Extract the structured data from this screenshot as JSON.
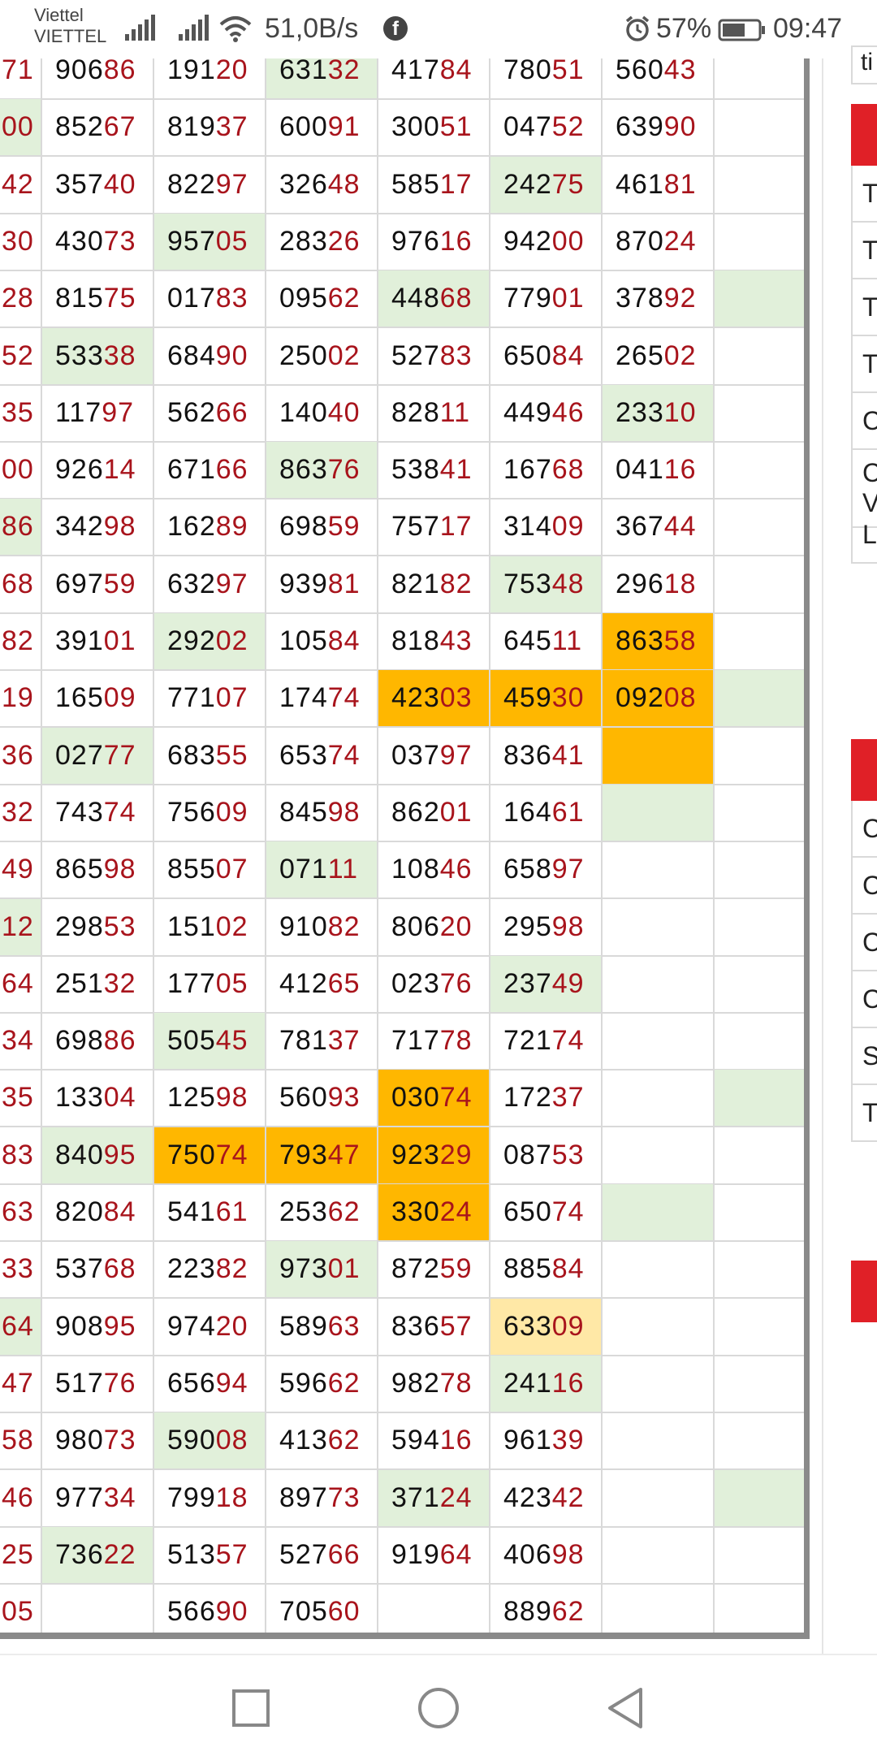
{
  "status_bar": {
    "carrier_line1": "Viettel",
    "carrier_line2": "VIETTEL",
    "net_speed": "51,0B/s",
    "battery": "57%",
    "time": "09:47",
    "icons": [
      "signal-icon",
      "signal-icon",
      "wifi-icon",
      "facebook-icon",
      "alarm-icon",
      "battery-icon"
    ]
  },
  "table": {
    "rows": [
      [
        {
          "a": "",
          "b": "71"
        },
        {
          "a": "906",
          "b": "86",
          "bg": ""
        },
        {
          "a": "191",
          "b": "20",
          "bg": ""
        },
        {
          "a": "631",
          "b": "32",
          "bg": "green"
        },
        {
          "a": "417",
          "b": "84",
          "bg": ""
        },
        {
          "a": "780",
          "b": "51",
          "bg": ""
        },
        {
          "a": "560",
          "b": "43",
          "bg": ""
        },
        {
          "a": "",
          "b": "",
          "bg": ""
        }
      ],
      [
        {
          "a": "",
          "b": "00",
          "bg": "green"
        },
        {
          "a": "852",
          "b": "67",
          "bg": ""
        },
        {
          "a": "819",
          "b": "37",
          "bg": ""
        },
        {
          "a": "600",
          "b": "91",
          "bg": ""
        },
        {
          "a": "300",
          "b": "51",
          "bg": ""
        },
        {
          "a": "047",
          "b": "52",
          "bg": ""
        },
        {
          "a": "639",
          "b": "90",
          "bg": ""
        },
        {
          "a": "",
          "b": "",
          "bg": ""
        }
      ],
      [
        {
          "a": "",
          "b": "42"
        },
        {
          "a": "357",
          "b": "40",
          "bg": ""
        },
        {
          "a": "822",
          "b": "97",
          "bg": ""
        },
        {
          "a": "326",
          "b": "48",
          "bg": ""
        },
        {
          "a": "585",
          "b": "17",
          "bg": ""
        },
        {
          "a": "242",
          "b": "75",
          "bg": "green"
        },
        {
          "a": "461",
          "b": "81",
          "bg": ""
        },
        {
          "a": "",
          "b": "",
          "bg": ""
        }
      ],
      [
        {
          "a": "",
          "b": "30"
        },
        {
          "a": "430",
          "b": "73",
          "bg": ""
        },
        {
          "a": "957",
          "b": "05",
          "bg": "green"
        },
        {
          "a": "283",
          "b": "26",
          "bg": ""
        },
        {
          "a": "976",
          "b": "16",
          "bg": ""
        },
        {
          "a": "942",
          "b": "00",
          "bg": ""
        },
        {
          "a": "870",
          "b": "24",
          "bg": ""
        },
        {
          "a": "",
          "b": "",
          "bg": ""
        }
      ],
      [
        {
          "a": "",
          "b": "28"
        },
        {
          "a": "815",
          "b": "75",
          "bg": ""
        },
        {
          "a": "017",
          "b": "83",
          "bg": ""
        },
        {
          "a": "095",
          "b": "62",
          "bg": ""
        },
        {
          "a": "448",
          "b": "68",
          "bg": "green"
        },
        {
          "a": "779",
          "b": "01",
          "bg": ""
        },
        {
          "a": "378",
          "b": "92",
          "bg": ""
        },
        {
          "a": "",
          "b": "",
          "bg": "green"
        }
      ],
      [
        {
          "a": "",
          "b": "52"
        },
        {
          "a": "533",
          "b": "38",
          "bg": "green"
        },
        {
          "a": "684",
          "b": "90",
          "bg": ""
        },
        {
          "a": "250",
          "b": "02",
          "bg": ""
        },
        {
          "a": "527",
          "b": "83",
          "bg": ""
        },
        {
          "a": "650",
          "b": "84",
          "bg": ""
        },
        {
          "a": "265",
          "b": "02",
          "bg": ""
        },
        {
          "a": "",
          "b": "",
          "bg": ""
        }
      ],
      [
        {
          "a": "",
          "b": "35"
        },
        {
          "a": "117",
          "b": "97",
          "bg": ""
        },
        {
          "a": "562",
          "b": "66",
          "bg": ""
        },
        {
          "a": "140",
          "b": "40",
          "bg": ""
        },
        {
          "a": "828",
          "b": "11",
          "bg": ""
        },
        {
          "a": "449",
          "b": "46",
          "bg": ""
        },
        {
          "a": "233",
          "b": "10",
          "bg": "green"
        },
        {
          "a": "",
          "b": "",
          "bg": ""
        }
      ],
      [
        {
          "a": "",
          "b": "00"
        },
        {
          "a": "926",
          "b": "14",
          "bg": ""
        },
        {
          "a": "671",
          "b": "66",
          "bg": ""
        },
        {
          "a": "863",
          "b": "76",
          "bg": "green"
        },
        {
          "a": "538",
          "b": "41",
          "bg": ""
        },
        {
          "a": "167",
          "b": "68",
          "bg": ""
        },
        {
          "a": "041",
          "b": "16",
          "bg": ""
        },
        {
          "a": "",
          "b": "",
          "bg": ""
        }
      ],
      [
        {
          "a": "",
          "b": "86",
          "bg": "green"
        },
        {
          "a": "342",
          "b": "98",
          "bg": ""
        },
        {
          "a": "162",
          "b": "89",
          "bg": ""
        },
        {
          "a": "698",
          "b": "59",
          "bg": ""
        },
        {
          "a": "757",
          "b": "17",
          "bg": ""
        },
        {
          "a": "314",
          "b": "09",
          "bg": ""
        },
        {
          "a": "367",
          "b": "44",
          "bg": ""
        },
        {
          "a": "",
          "b": "",
          "bg": ""
        }
      ],
      [
        {
          "a": "",
          "b": "68"
        },
        {
          "a": "697",
          "b": "59",
          "bg": ""
        },
        {
          "a": "632",
          "b": "97",
          "bg": ""
        },
        {
          "a": "939",
          "b": "81",
          "bg": ""
        },
        {
          "a": "821",
          "b": "82",
          "bg": ""
        },
        {
          "a": "753",
          "b": "48",
          "bg": "green"
        },
        {
          "a": "296",
          "b": "18",
          "bg": ""
        },
        {
          "a": "",
          "b": "",
          "bg": ""
        }
      ],
      [
        {
          "a": "",
          "b": "82"
        },
        {
          "a": "391",
          "b": "01",
          "bg": ""
        },
        {
          "a": "292",
          "b": "02",
          "bg": "green"
        },
        {
          "a": "105",
          "b": "84",
          "bg": ""
        },
        {
          "a": "818",
          "b": "43",
          "bg": ""
        },
        {
          "a": "645",
          "b": "11",
          "bg": ""
        },
        {
          "a": "863",
          "b": "58",
          "bg": "orange"
        },
        {
          "a": "",
          "b": "",
          "bg": ""
        }
      ],
      [
        {
          "a": "",
          "b": "19"
        },
        {
          "a": "165",
          "b": "09",
          "bg": ""
        },
        {
          "a": "771",
          "b": "07",
          "bg": ""
        },
        {
          "a": "174",
          "b": "74",
          "bg": ""
        },
        {
          "a": "423",
          "b": "03",
          "bg": "orange"
        },
        {
          "a": "459",
          "b": "30",
          "bg": "orange"
        },
        {
          "a": "092",
          "b": "08",
          "bg": "orange"
        },
        {
          "a": "",
          "b": "",
          "bg": "green"
        }
      ],
      [
        {
          "a": "",
          "b": "36"
        },
        {
          "a": "027",
          "b": "77",
          "bg": "green"
        },
        {
          "a": "683",
          "b": "55",
          "bg": ""
        },
        {
          "a": "653",
          "b": "74",
          "bg": ""
        },
        {
          "a": "037",
          "b": "97",
          "bg": ""
        },
        {
          "a": "836",
          "b": "41",
          "bg": ""
        },
        {
          "a": "",
          "b": "",
          "bg": "orange"
        },
        {
          "a": "",
          "b": "",
          "bg": ""
        }
      ],
      [
        {
          "a": "",
          "b": "32"
        },
        {
          "a": "743",
          "b": "74",
          "bg": ""
        },
        {
          "a": "756",
          "b": "09",
          "bg": ""
        },
        {
          "a": "845",
          "b": "98",
          "bg": ""
        },
        {
          "a": "862",
          "b": "01",
          "bg": ""
        },
        {
          "a": "164",
          "b": "61",
          "bg": ""
        },
        {
          "a": "",
          "b": "",
          "bg": "green"
        },
        {
          "a": "",
          "b": "",
          "bg": ""
        }
      ],
      [
        {
          "a": "",
          "b": "49"
        },
        {
          "a": "865",
          "b": "98",
          "bg": ""
        },
        {
          "a": "855",
          "b": "07",
          "bg": ""
        },
        {
          "a": "071",
          "b": "11",
          "bg": "green"
        },
        {
          "a": "108",
          "b": "46",
          "bg": ""
        },
        {
          "a": "658",
          "b": "97",
          "bg": ""
        },
        {
          "a": "",
          "b": "",
          "bg": ""
        },
        {
          "a": "",
          "b": "",
          "bg": ""
        }
      ],
      [
        {
          "a": "",
          "b": "12",
          "bg": "green"
        },
        {
          "a": "298",
          "b": "53",
          "bg": ""
        },
        {
          "a": "151",
          "b": "02",
          "bg": ""
        },
        {
          "a": "910",
          "b": "82",
          "bg": ""
        },
        {
          "a": "806",
          "b": "20",
          "bg": ""
        },
        {
          "a": "295",
          "b": "98",
          "bg": ""
        },
        {
          "a": "",
          "b": "",
          "bg": ""
        },
        {
          "a": "",
          "b": "",
          "bg": ""
        }
      ],
      [
        {
          "a": "",
          "b": "64"
        },
        {
          "a": "251",
          "b": "32",
          "bg": ""
        },
        {
          "a": "177",
          "b": "05",
          "bg": ""
        },
        {
          "a": "412",
          "b": "65",
          "bg": ""
        },
        {
          "a": "023",
          "b": "76",
          "bg": ""
        },
        {
          "a": "237",
          "b": "49",
          "bg": "green"
        },
        {
          "a": "",
          "b": "",
          "bg": ""
        },
        {
          "a": "",
          "b": "",
          "bg": ""
        }
      ],
      [
        {
          "a": "",
          "b": "34"
        },
        {
          "a": "698",
          "b": "86",
          "bg": ""
        },
        {
          "a": "505",
          "b": "45",
          "bg": "green"
        },
        {
          "a": "781",
          "b": "37",
          "bg": ""
        },
        {
          "a": "717",
          "b": "78",
          "bg": ""
        },
        {
          "a": "721",
          "b": "74",
          "bg": ""
        },
        {
          "a": "",
          "b": "",
          "bg": ""
        },
        {
          "a": "",
          "b": "",
          "bg": ""
        }
      ],
      [
        {
          "a": "",
          "b": "35"
        },
        {
          "a": "133",
          "b": "04",
          "bg": ""
        },
        {
          "a": "125",
          "b": "98",
          "bg": ""
        },
        {
          "a": "560",
          "b": "93",
          "bg": ""
        },
        {
          "a": "030",
          "b": "74",
          "bg": "orange"
        },
        {
          "a": "172",
          "b": "37",
          "bg": ""
        },
        {
          "a": "",
          "b": "",
          "bg": ""
        },
        {
          "a": "",
          "b": "",
          "bg": "green"
        }
      ],
      [
        {
          "a": "",
          "b": "83"
        },
        {
          "a": "840",
          "b": "95",
          "bg": "green"
        },
        {
          "a": "750",
          "b": "74",
          "bg": "orange"
        },
        {
          "a": "793",
          "b": "47",
          "bg": "orange"
        },
        {
          "a": "923",
          "b": "29",
          "bg": "orange"
        },
        {
          "a": "087",
          "b": "53",
          "bg": ""
        },
        {
          "a": "",
          "b": "",
          "bg": ""
        },
        {
          "a": "",
          "b": "",
          "bg": ""
        }
      ],
      [
        {
          "a": "",
          "b": "63"
        },
        {
          "a": "820",
          "b": "84",
          "bg": ""
        },
        {
          "a": "541",
          "b": "61",
          "bg": ""
        },
        {
          "a": "253",
          "b": "62",
          "bg": ""
        },
        {
          "a": "330",
          "b": "24",
          "bg": "orange"
        },
        {
          "a": "650",
          "b": "74",
          "bg": ""
        },
        {
          "a": "",
          "b": "",
          "bg": "green"
        },
        {
          "a": "",
          "b": "",
          "bg": ""
        }
      ],
      [
        {
          "a": "",
          "b": "33"
        },
        {
          "a": "537",
          "b": "68",
          "bg": ""
        },
        {
          "a": "223",
          "b": "82",
          "bg": ""
        },
        {
          "a": "973",
          "b": "01",
          "bg": "green"
        },
        {
          "a": "872",
          "b": "59",
          "bg": ""
        },
        {
          "a": "885",
          "b": "84",
          "bg": ""
        },
        {
          "a": "",
          "b": "",
          "bg": ""
        },
        {
          "a": "",
          "b": "",
          "bg": ""
        }
      ],
      [
        {
          "a": "",
          "b": "64",
          "bg": "green"
        },
        {
          "a": "908",
          "b": "95",
          "bg": ""
        },
        {
          "a": "974",
          "b": "20",
          "bg": ""
        },
        {
          "a": "589",
          "b": "63",
          "bg": ""
        },
        {
          "a": "836",
          "b": "57",
          "bg": ""
        },
        {
          "a": "633",
          "b": "09",
          "bg": "yellow"
        },
        {
          "a": "",
          "b": "",
          "bg": ""
        },
        {
          "a": "",
          "b": "",
          "bg": ""
        }
      ],
      [
        {
          "a": "",
          "b": "47"
        },
        {
          "a": "517",
          "b": "76",
          "bg": ""
        },
        {
          "a": "656",
          "b": "94",
          "bg": ""
        },
        {
          "a": "596",
          "b": "62",
          "bg": ""
        },
        {
          "a": "982",
          "b": "78",
          "bg": ""
        },
        {
          "a": "241",
          "b": "16",
          "bg": "green"
        },
        {
          "a": "",
          "b": "",
          "bg": ""
        },
        {
          "a": "",
          "b": "",
          "bg": ""
        }
      ],
      [
        {
          "a": "",
          "b": "58"
        },
        {
          "a": "980",
          "b": "73",
          "bg": ""
        },
        {
          "a": "590",
          "b": "08",
          "bg": "green"
        },
        {
          "a": "413",
          "b": "62",
          "bg": ""
        },
        {
          "a": "594",
          "b": "16",
          "bg": ""
        },
        {
          "a": "961",
          "b": "39",
          "bg": ""
        },
        {
          "a": "",
          "b": "",
          "bg": ""
        },
        {
          "a": "",
          "b": "",
          "bg": ""
        }
      ],
      [
        {
          "a": "",
          "b": "46"
        },
        {
          "a": "977",
          "b": "34",
          "bg": ""
        },
        {
          "a": "799",
          "b": "18",
          "bg": ""
        },
        {
          "a": "897",
          "b": "73",
          "bg": ""
        },
        {
          "a": "371",
          "b": "24",
          "bg": "green"
        },
        {
          "a": "423",
          "b": "42",
          "bg": ""
        },
        {
          "a": "",
          "b": "",
          "bg": ""
        },
        {
          "a": "",
          "b": "",
          "bg": "green"
        }
      ],
      [
        {
          "a": "",
          "b": "25"
        },
        {
          "a": "736",
          "b": "22",
          "bg": "green"
        },
        {
          "a": "513",
          "b": "57",
          "bg": ""
        },
        {
          "a": "527",
          "b": "66",
          "bg": ""
        },
        {
          "a": "919",
          "b": "64",
          "bg": ""
        },
        {
          "a": "406",
          "b": "98",
          "bg": ""
        },
        {
          "a": "",
          "b": "",
          "bg": ""
        },
        {
          "a": "",
          "b": "",
          "bg": ""
        }
      ],
      [
        {
          "a": "",
          "b": "05"
        },
        {
          "a": "",
          "b": "",
          "bg": ""
        },
        {
          "a": "566",
          "b": "90",
          "bg": ""
        },
        {
          "a": "705",
          "b": "60",
          "bg": ""
        },
        {
          "a": "",
          "b": "",
          "bg": ""
        },
        {
          "a": "889",
          "b": "62",
          "bg": ""
        },
        {
          "a": "",
          "b": "",
          "bg": ""
        },
        {
          "a": "",
          "b": "",
          "bg": ""
        }
      ]
    ]
  },
  "side_panel": {
    "top_text": "ti",
    "section1_rows": [
      "T",
      "T",
      "T",
      "T",
      "C",
      "C V",
      "L"
    ],
    "section2_rows": [
      "C",
      "C",
      "C",
      "C",
      "S",
      "T"
    ],
    "accent_color": "#e02027"
  },
  "colors": {
    "highlight_green": "#e1f0da",
    "highlight_orange": "#ffb700",
    "highlight_yellow": "#ffe8a6",
    "number_dark": "#111111",
    "number_red": "#a8141c"
  },
  "nav_bar": {
    "icons": [
      "recent-apps-icon",
      "home-icon",
      "back-icon"
    ]
  }
}
